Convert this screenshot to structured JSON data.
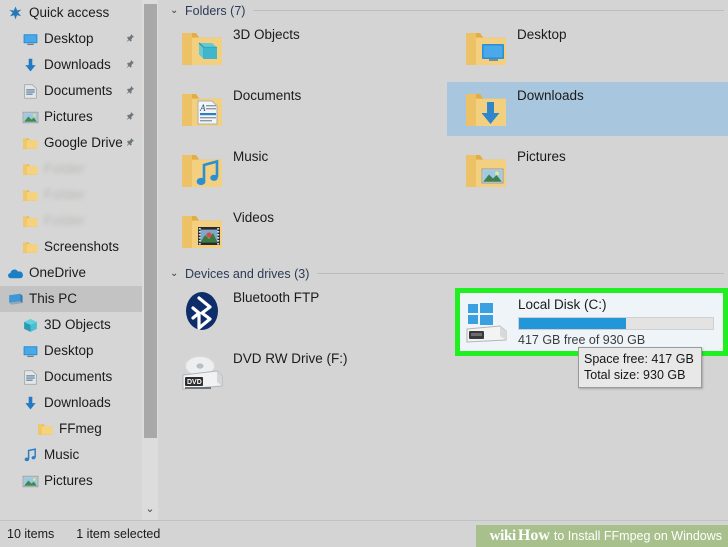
{
  "window": {
    "title": "This PC"
  },
  "sidebar": {
    "items": [
      {
        "label": "Quick access",
        "icon": "star-icon",
        "level": 0,
        "pinned": false,
        "selected": false,
        "blurred": false
      },
      {
        "label": "Desktop",
        "icon": "desktop-icon",
        "level": 1,
        "pinned": true,
        "selected": false,
        "blurred": false
      },
      {
        "label": "Downloads",
        "icon": "downloads-icon",
        "level": 1,
        "pinned": true,
        "selected": false,
        "blurred": false
      },
      {
        "label": "Documents",
        "icon": "documents-icon",
        "level": 1,
        "pinned": true,
        "selected": false,
        "blurred": false
      },
      {
        "label": "Pictures",
        "icon": "pictures-icon",
        "level": 1,
        "pinned": true,
        "selected": false,
        "blurred": false
      },
      {
        "label": "Google Drive",
        "icon": "folder-icon",
        "level": 1,
        "pinned": true,
        "selected": false,
        "blurred": false
      },
      {
        "label": "Folder",
        "icon": "folder-icon",
        "level": 1,
        "pinned": false,
        "selected": false,
        "blurred": true
      },
      {
        "label": "Folder",
        "icon": "folder-icon",
        "level": 1,
        "pinned": false,
        "selected": false,
        "blurred": true
      },
      {
        "label": "Folder",
        "icon": "folder-icon",
        "level": 1,
        "pinned": false,
        "selected": false,
        "blurred": true
      },
      {
        "label": "Screenshots",
        "icon": "folder-icon",
        "level": 1,
        "pinned": false,
        "selected": false,
        "blurred": false
      },
      {
        "label": "OneDrive",
        "icon": "onedrive-icon",
        "level": 0,
        "pinned": false,
        "selected": false,
        "blurred": false
      },
      {
        "label": "This PC",
        "icon": "thispc-icon",
        "level": 0,
        "pinned": false,
        "selected": true,
        "blurred": false
      },
      {
        "label": "3D Objects",
        "icon": "3dobjects-icon",
        "level": 1,
        "pinned": false,
        "selected": false,
        "blurred": false
      },
      {
        "label": "Desktop",
        "icon": "desktop-icon",
        "level": 1,
        "pinned": false,
        "selected": false,
        "blurred": false
      },
      {
        "label": "Documents",
        "icon": "documents-icon",
        "level": 1,
        "pinned": false,
        "selected": false,
        "blurred": false
      },
      {
        "label": "Downloads",
        "icon": "downloads-icon",
        "level": 1,
        "pinned": false,
        "selected": false,
        "blurred": false
      },
      {
        "label": "FFmeg",
        "icon": "folder-icon",
        "level": 2,
        "pinned": false,
        "selected": false,
        "blurred": false
      },
      {
        "label": "Music",
        "icon": "music-icon",
        "level": 1,
        "pinned": false,
        "selected": false,
        "blurred": false
      },
      {
        "label": "Pictures",
        "icon": "pictures-icon",
        "level": 1,
        "pinned": false,
        "selected": false,
        "blurred": false
      }
    ],
    "scroll_down_glyph": "⌄"
  },
  "main": {
    "folders_section": {
      "label": "Folders (7)",
      "chevron": "⌄",
      "items": [
        {
          "name": "3D Objects",
          "icon": "folder-3dobjects-icon",
          "selected": false,
          "col": 0,
          "row": 0
        },
        {
          "name": "Desktop",
          "icon": "folder-desktop-icon",
          "selected": false,
          "col": 1,
          "row": 0
        },
        {
          "name": "Documents",
          "icon": "folder-documents-icon",
          "selected": false,
          "col": 0,
          "row": 1
        },
        {
          "name": "Downloads",
          "icon": "folder-downloads-icon",
          "selected": true,
          "col": 1,
          "row": 1
        },
        {
          "name": "Music",
          "icon": "folder-music-icon",
          "selected": false,
          "col": 0,
          "row": 2
        },
        {
          "name": "Pictures",
          "icon": "folder-pictures-icon",
          "selected": false,
          "col": 1,
          "row": 2
        },
        {
          "name": "Videos",
          "icon": "folder-videos-icon",
          "selected": false,
          "col": 0,
          "row": 3
        }
      ]
    },
    "devices_section": {
      "label": "Devices and drives (3)",
      "chevron": "⌄",
      "items": [
        {
          "name": "Bluetooth FTP",
          "icon": "bluetooth-icon",
          "type": "device"
        },
        {
          "name": "DVD RW Drive (F:)",
          "icon": "dvd-icon",
          "type": "device"
        }
      ],
      "local_disk": {
        "name": "Local Disk (C:)",
        "capacity_text": "417 GB free of 930 GB",
        "free_gb": 417,
        "total_gb": 930,
        "used_percent": 55,
        "highlighted": true,
        "highlight_color": "#22ef22",
        "bar_color": "#2196d8",
        "icon": "local-disk-icon"
      }
    },
    "tooltip": {
      "space_free": "Space free: 417 GB",
      "total_size": "Total size: 930 GB"
    }
  },
  "statusbar": {
    "item_count": "10 items",
    "selection": "1 item selected"
  },
  "watermark": {
    "wiki": "wiki",
    "how": "How",
    "rest": "to Install FFmpeg on Windows",
    "bg_color": "#a8c08c"
  }
}
